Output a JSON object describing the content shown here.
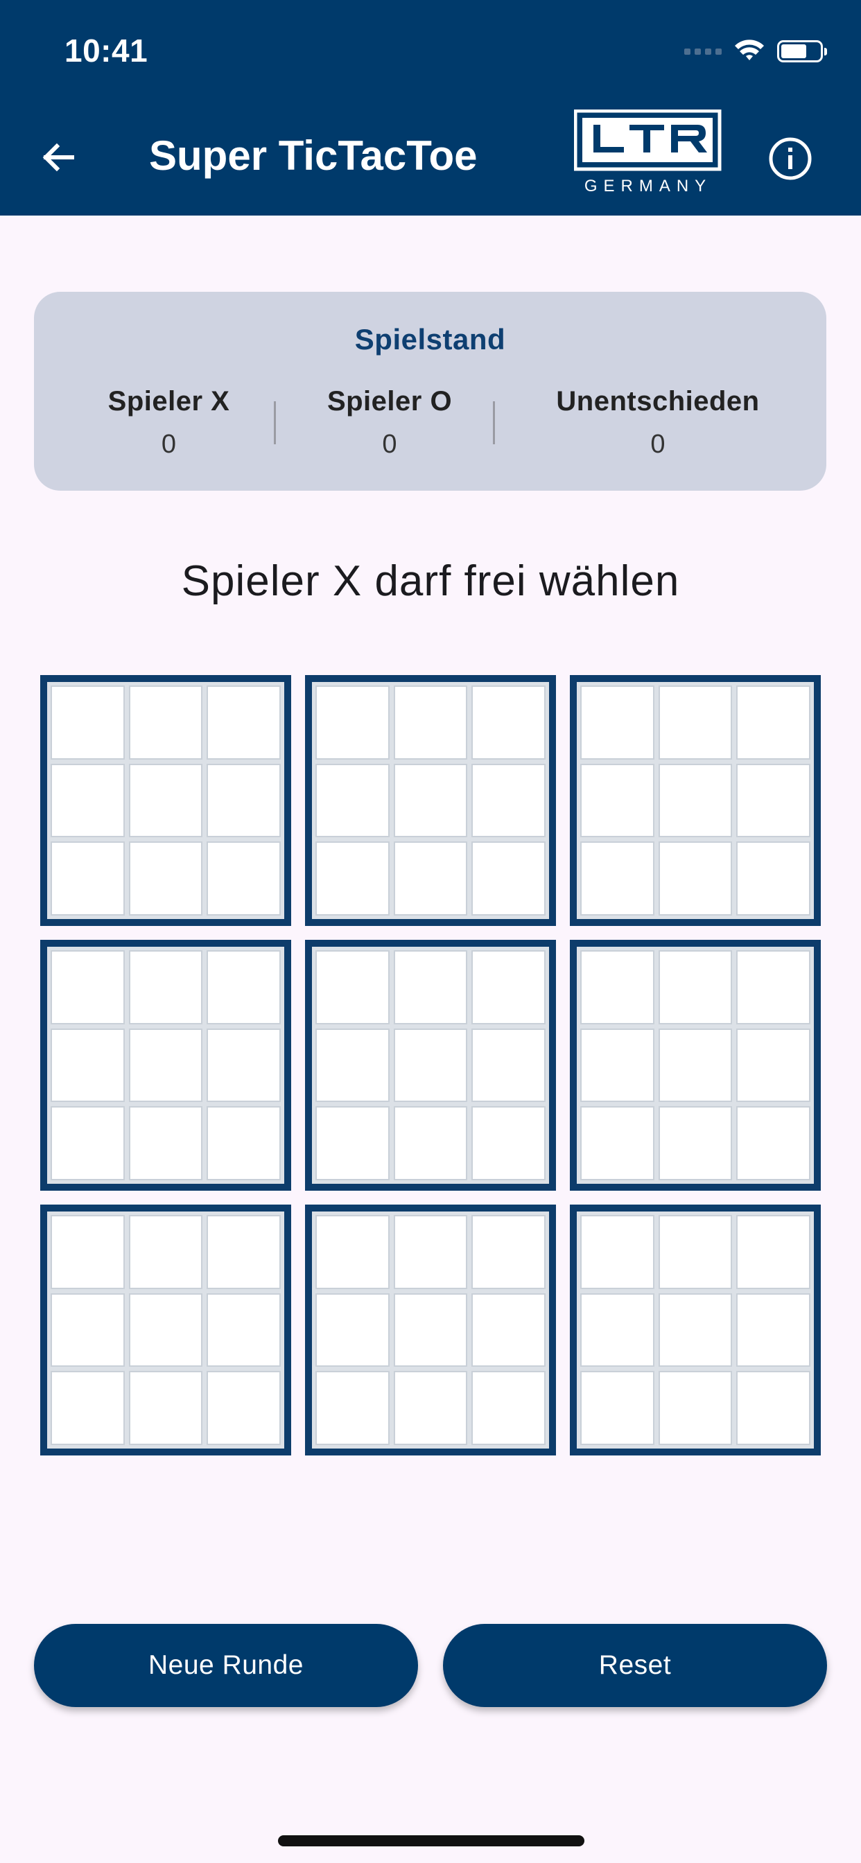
{
  "status_bar": {
    "time": "10:41"
  },
  "app_bar": {
    "title": "Super TicTacToe",
    "back_icon": "arrow-left-icon",
    "info_icon": "info-icon",
    "logo": {
      "letters": "LTR",
      "subtitle": "GERMANY"
    }
  },
  "scoreboard": {
    "title": "Spielstand",
    "players": [
      {
        "name": "Spieler X",
        "score": "0"
      },
      {
        "name": "Spieler O",
        "score": "0"
      },
      {
        "name": "Unentschieden",
        "score": "0"
      }
    ]
  },
  "status_message": "Spieler X darf frei wählen",
  "board": {
    "sub_boards": 9,
    "cells_per_board": 9,
    "cells": [
      [
        "",
        "",
        "",
        "",
        "",
        "",
        "",
        "",
        ""
      ],
      [
        "",
        "",
        "",
        "",
        "",
        "",
        "",
        "",
        ""
      ],
      [
        "",
        "",
        "",
        "",
        "",
        "",
        "",
        "",
        ""
      ],
      [
        "",
        "",
        "",
        "",
        "",
        "",
        "",
        "",
        ""
      ],
      [
        "",
        "",
        "",
        "",
        "",
        "",
        "",
        "",
        ""
      ],
      [
        "",
        "",
        "",
        "",
        "",
        "",
        "",
        "",
        ""
      ],
      [
        "",
        "",
        "",
        "",
        "",
        "",
        "",
        "",
        ""
      ],
      [
        "",
        "",
        "",
        "",
        "",
        "",
        "",
        "",
        ""
      ],
      [
        "",
        "",
        "",
        "",
        "",
        "",
        "",
        "",
        ""
      ]
    ]
  },
  "actions": {
    "new_round": "Neue Runde",
    "reset": "Reset"
  },
  "colors": {
    "primary": "#003a6b",
    "background": "#fcf5fd",
    "card": "#cfd3e1",
    "board_border": "#0d3c6b"
  }
}
